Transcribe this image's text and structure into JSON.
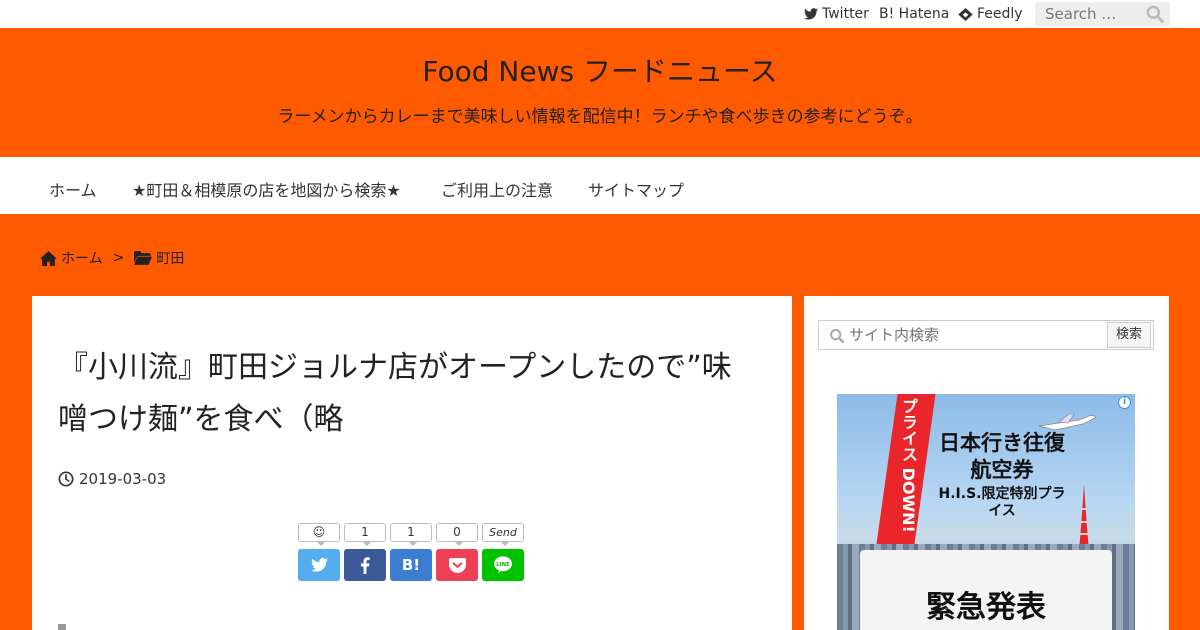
{
  "topbar": {
    "twitter": "Twitter",
    "hatena": "B! Hatena",
    "feedly": "Feedly",
    "search_placeholder": "Search …"
  },
  "header": {
    "title": "Food News フードニュース",
    "tagline": "ラーメンからカレーまで美味しい情報を配信中！ランチや食べ歩きの参考にどうぞ。"
  },
  "nav": {
    "items": [
      "ホーム",
      "★町田＆相模原の店を地図から検索★",
      "ご利用上の注意",
      "サイトマップ"
    ]
  },
  "breadcrumb": {
    "home": "ホーム",
    "separator": ">",
    "category": "町田"
  },
  "article": {
    "title": "『小川流』町田ジョルナ店がオープンしたので”味噌つけ麺”を食べ（略",
    "date": "2019-03-03"
  },
  "share": {
    "counts": [
      "☺",
      "1",
      "1",
      "0",
      "Send"
    ],
    "buttons": [
      "twitter",
      "facebook",
      "B!",
      "pocket",
      "line"
    ]
  },
  "sidebar": {
    "search_placeholder": "サイト内検索",
    "search_button": "検索"
  },
  "ad": {
    "ribbon": "プライス DOWN!",
    "headline": "日本行き往復航空券",
    "subline": "H.I.S.限定特別プライス",
    "card_text": "緊急発表",
    "adchoice": "i"
  },
  "colors": {
    "accent": "#ff5a00",
    "twitter": "#55acee",
    "facebook": "#3b5998",
    "hatena": "#3c7dd1",
    "pocket": "#ee4056",
    "line": "#00c300"
  }
}
